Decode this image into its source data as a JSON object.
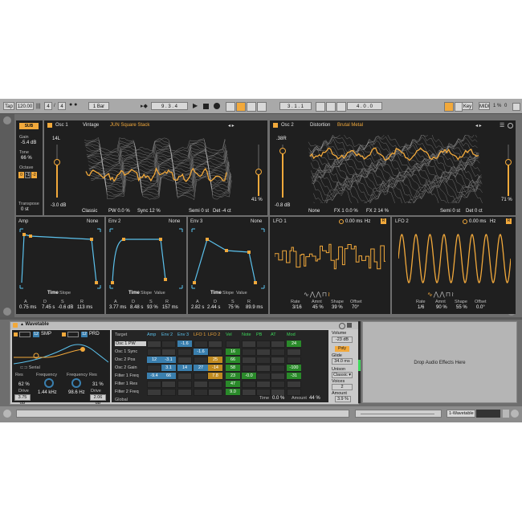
{
  "transport": {
    "tap": "Tap",
    "tempo": "120.00",
    "time_sig_num": "4",
    "time_sig_den": "4",
    "quantize": "1 Bar",
    "position": "9 . 3 . 4",
    "loop_start": "3 . 1 . 1",
    "loop_length": "4 . 0 . 0",
    "key": "Key",
    "midi": "MIDI",
    "cpu": "1 %",
    "disk": "0"
  },
  "sub": {
    "badge": "SUB",
    "gain_label": "Gain",
    "gain_value": "-5.4 dB",
    "tone_label": "Tone",
    "tone_value": "66 %",
    "octave_label": "Octave",
    "octave_options": [
      "0",
      "-1",
      "-2"
    ],
    "transpose_label": "Transpose",
    "transpose_value": "0 st"
  },
  "osc1": {
    "title": "Osc 1",
    "category": "Vintage",
    "wavetable": "JUN Square Stack",
    "position_label": "14L",
    "level": "-3.0 dB",
    "mode": "Classic",
    "pw": "PW 0.0 %",
    "sync": "Sync 12 %",
    "semi": "Semi 0 st",
    "det": "Det -4 ct",
    "mix": "41 %"
  },
  "osc2": {
    "title": "Osc 2",
    "category": "Distortion",
    "wavetable": "Brutal Metal",
    "position_label": ".38R",
    "level": "-0.8 dB",
    "mode": "None",
    "fx1": "FX 1 0.0 %",
    "fx2": "FX 2 14 %",
    "semi": "Semi 0 st",
    "det": "Det 0 ct",
    "mix": "71 %"
  },
  "envelopes": [
    {
      "name": "Amp",
      "mode": "None",
      "a": "0.75 ms",
      "d": "7.45 s",
      "s": "-0.6 dB",
      "r": "113 ms",
      "tabs": [
        "Time",
        "Slope"
      ]
    },
    {
      "name": "Env 2",
      "mode": "None",
      "a": "3.77 ms",
      "d": "8.48 s",
      "s": "93 %",
      "r": "157 ms",
      "tabs": [
        "Time",
        "Slope",
        "Value"
      ]
    },
    {
      "name": "Env 3",
      "mode": "None",
      "a": "2.82 s",
      "d": "2.44 s",
      "s": "75 %",
      "r": "89.9 ms",
      "tabs": [
        "Time",
        "Slope",
        "Value"
      ]
    }
  ],
  "env_param_labels": [
    "A",
    "D",
    "S",
    "R"
  ],
  "lfos": [
    {
      "name": "LFO 1",
      "time": "0.00 ms",
      "hz": "Hz",
      "rate": "3/16",
      "amnt": "45 %",
      "shape": "39 %",
      "offset": "70°"
    },
    {
      "name": "LFO 2",
      "time": "0.00 ms",
      "hz": "Hz",
      "rate": "1/6",
      "amnt": "90 %",
      "shape": "55 %",
      "offset": "0.0°"
    }
  ],
  "lfo_param_labels": [
    "Rate",
    "Amnt",
    "Shape",
    "Offset"
  ],
  "device": {
    "title": "Wavetable",
    "filter1_num": "12",
    "filter1_type": "SMP",
    "filter2_num": "12",
    "filter2_type": "PRD",
    "routing": "Serial",
    "res1_label": "Res",
    "res1_value": "62 %",
    "freq1_label": "Frequency",
    "freq1_value": "1.44 kHz",
    "drive1_label": "Drive",
    "drive1_value": "3.75 dB",
    "freq2_label": "Frequency",
    "freq2_value": "98.6 Hz",
    "res2_label": "Res",
    "res2_value": "31 %",
    "drive2_label": "Drive",
    "drive2_value": "2.06 dB"
  },
  "matrix": {
    "target_label": "Target",
    "columns": [
      "Amp",
      "Env 2",
      "Env 3",
      "LFO 1",
      "LFO 2",
      "Vel",
      "Note",
      "PB",
      "AT",
      "Mod"
    ],
    "rows": [
      "Osc 1 PW",
      "Osc 1 Sync",
      "Osc 2 Pos",
      "Osc 2 Gain",
      "Filter 1 Freq",
      "Filter 1 Res",
      "Filter 2 Freq"
    ],
    "cells": [
      {
        "row": 0,
        "col": 2,
        "text": "-1.6",
        "color": "#3a7fae"
      },
      {
        "row": 0,
        "col": 9,
        "text": "24",
        "color": "#2a8a2a"
      },
      {
        "row": 1,
        "col": 3,
        "text": "-1.6",
        "color": "#3a7fae"
      },
      {
        "row": 1,
        "col": 5,
        "text": "16",
        "color": "#2a8a2a"
      },
      {
        "row": 2,
        "col": 0,
        "text": "12",
        "color": "#3a7fae"
      },
      {
        "row": 2,
        "col": 1,
        "text": "-3.1",
        "color": "#3a7fae"
      },
      {
        "row": 2,
        "col": 4,
        "text": "25",
        "color": "#c08a20"
      },
      {
        "row": 2,
        "col": 5,
        "text": "66",
        "color": "#2a8a2a"
      },
      {
        "row": 3,
        "col": 1,
        "text": "3.1",
        "color": "#3a7fae"
      },
      {
        "row": 3,
        "col": 2,
        "text": "14",
        "color": "#3a7fae"
      },
      {
        "row": 3,
        "col": 3,
        "text": "27",
        "color": "#3a7fae"
      },
      {
        "row": 3,
        "col": 4,
        "text": "-14",
        "color": "#c08a20"
      },
      {
        "row": 3,
        "col": 5,
        "text": "58",
        "color": "#2a8a2a"
      },
      {
        "row": 3,
        "col": 9,
        "text": "-100",
        "color": "#2a8a2a"
      },
      {
        "row": 4,
        "col": 0,
        "text": "-9.4",
        "color": "#3a7fae"
      },
      {
        "row": 4,
        "col": 1,
        "text": "66",
        "color": "#3a7fae"
      },
      {
        "row": 4,
        "col": 4,
        "text": "7.8",
        "color": "#c08a20"
      },
      {
        "row": 4,
        "col": 5,
        "text": "23",
        "color": "#2a8a2a"
      },
      {
        "row": 4,
        "col": 6,
        "text": "-0.0",
        "color": "#2a8a2a"
      },
      {
        "row": 4,
        "col": 9,
        "text": "-31",
        "color": "#2a8a2a"
      },
      {
        "row": 5,
        "col": 5,
        "text": "47",
        "color": "#2a8a2a"
      },
      {
        "row": 6,
        "col": 5,
        "text": "9.0",
        "color": "#2a8a2a"
      }
    ],
    "global_label": "Global",
    "time_label": "Time",
    "time_value": "0.0 %",
    "amount_label": "Amount",
    "amount_value": "44 %"
  },
  "global": {
    "volume_label": "Volume",
    "volume_value": "-23 dB",
    "poly_label": "Poly",
    "glide_label": "Glide",
    "glide_value": "34.0 ms",
    "unison_label": "Unison",
    "unison_mode": "Classic",
    "voices_label": "Voices",
    "voices_value": "2",
    "amount_label": "Amount",
    "amount_value": "3.9 %"
  },
  "drop_zone": "Drop Audio Effects Here",
  "status": {
    "track_name": "1-Wavetable"
  },
  "colors": {
    "accent": "#f2a93b",
    "envelope_line": "#5bc0eb",
    "panel_bg": "#1f1f1f"
  }
}
